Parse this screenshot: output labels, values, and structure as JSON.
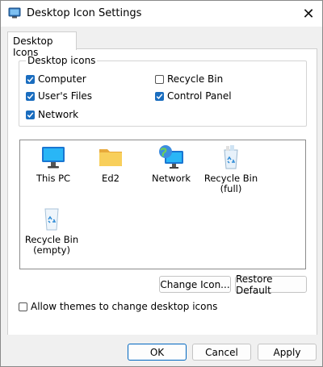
{
  "window": {
    "title": "Desktop Icon Settings"
  },
  "tabs": [
    {
      "label": "Desktop Icons"
    }
  ],
  "group": {
    "legend": "Desktop icons",
    "checkboxes": [
      {
        "label": "Computer",
        "checked": true
      },
      {
        "label": "Recycle Bin",
        "checked": false
      },
      {
        "label": "User's Files",
        "checked": true
      },
      {
        "label": "Control Panel",
        "checked": true
      },
      {
        "label": "Network",
        "checked": true
      }
    ]
  },
  "icons": [
    {
      "label": "This PC",
      "icon": "monitor-icon"
    },
    {
      "label": "Ed2",
      "icon": "folder-icon"
    },
    {
      "label": "Network",
      "icon": "network-globe-icon"
    },
    {
      "label": "Recycle Bin\n(full)",
      "icon": "recycle-bin-full-icon"
    },
    {
      "label": "Recycle Bin\n(empty)",
      "icon": "recycle-bin-empty-icon"
    }
  ],
  "actions": {
    "change_icon": "Change Icon...",
    "restore_default": "Restore Default"
  },
  "allow_themes": {
    "label": "Allow themes to change desktop icons",
    "checked": false
  },
  "footer": {
    "ok": "OK",
    "cancel": "Cancel",
    "apply": "Apply"
  },
  "colors": {
    "accent": "#1a6dbf",
    "folder": "#f5c342",
    "monitor": "#1e88e5"
  }
}
